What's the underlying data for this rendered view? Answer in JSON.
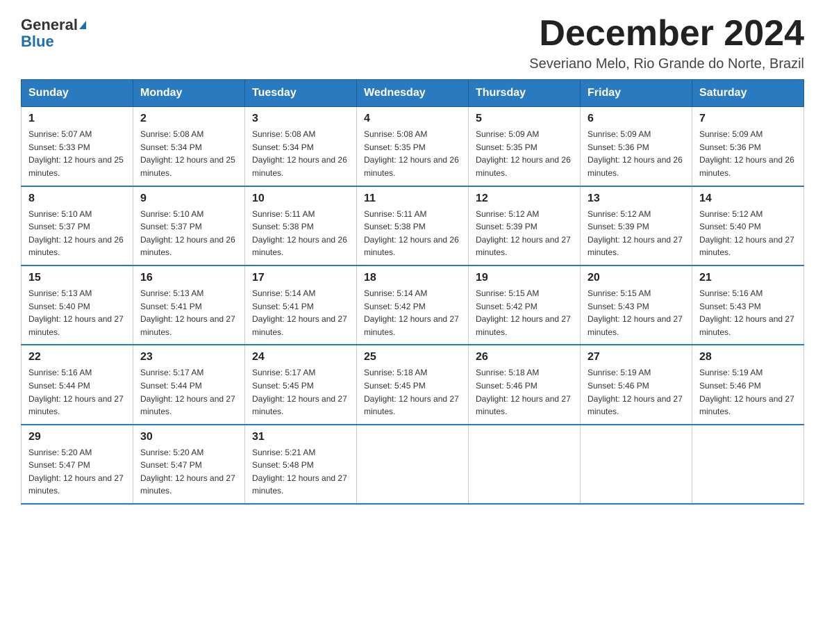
{
  "header": {
    "logo_general": "General",
    "logo_blue": "Blue",
    "month_title": "December 2024",
    "location": "Severiano Melo, Rio Grande do Norte, Brazil"
  },
  "weekdays": [
    "Sunday",
    "Monday",
    "Tuesday",
    "Wednesday",
    "Thursday",
    "Friday",
    "Saturday"
  ],
  "weeks": [
    [
      {
        "day": "1",
        "sunrise": "5:07 AM",
        "sunset": "5:33 PM",
        "daylight": "12 hours and 25 minutes."
      },
      {
        "day": "2",
        "sunrise": "5:08 AM",
        "sunset": "5:34 PM",
        "daylight": "12 hours and 25 minutes."
      },
      {
        "day": "3",
        "sunrise": "5:08 AM",
        "sunset": "5:34 PM",
        "daylight": "12 hours and 26 minutes."
      },
      {
        "day": "4",
        "sunrise": "5:08 AM",
        "sunset": "5:35 PM",
        "daylight": "12 hours and 26 minutes."
      },
      {
        "day": "5",
        "sunrise": "5:09 AM",
        "sunset": "5:35 PM",
        "daylight": "12 hours and 26 minutes."
      },
      {
        "day": "6",
        "sunrise": "5:09 AM",
        "sunset": "5:36 PM",
        "daylight": "12 hours and 26 minutes."
      },
      {
        "day": "7",
        "sunrise": "5:09 AM",
        "sunset": "5:36 PM",
        "daylight": "12 hours and 26 minutes."
      }
    ],
    [
      {
        "day": "8",
        "sunrise": "5:10 AM",
        "sunset": "5:37 PM",
        "daylight": "12 hours and 26 minutes."
      },
      {
        "day": "9",
        "sunrise": "5:10 AM",
        "sunset": "5:37 PM",
        "daylight": "12 hours and 26 minutes."
      },
      {
        "day": "10",
        "sunrise": "5:11 AM",
        "sunset": "5:38 PM",
        "daylight": "12 hours and 26 minutes."
      },
      {
        "day": "11",
        "sunrise": "5:11 AM",
        "sunset": "5:38 PM",
        "daylight": "12 hours and 26 minutes."
      },
      {
        "day": "12",
        "sunrise": "5:12 AM",
        "sunset": "5:39 PM",
        "daylight": "12 hours and 27 minutes."
      },
      {
        "day": "13",
        "sunrise": "5:12 AM",
        "sunset": "5:39 PM",
        "daylight": "12 hours and 27 minutes."
      },
      {
        "day": "14",
        "sunrise": "5:12 AM",
        "sunset": "5:40 PM",
        "daylight": "12 hours and 27 minutes."
      }
    ],
    [
      {
        "day": "15",
        "sunrise": "5:13 AM",
        "sunset": "5:40 PM",
        "daylight": "12 hours and 27 minutes."
      },
      {
        "day": "16",
        "sunrise": "5:13 AM",
        "sunset": "5:41 PM",
        "daylight": "12 hours and 27 minutes."
      },
      {
        "day": "17",
        "sunrise": "5:14 AM",
        "sunset": "5:41 PM",
        "daylight": "12 hours and 27 minutes."
      },
      {
        "day": "18",
        "sunrise": "5:14 AM",
        "sunset": "5:42 PM",
        "daylight": "12 hours and 27 minutes."
      },
      {
        "day": "19",
        "sunrise": "5:15 AM",
        "sunset": "5:42 PM",
        "daylight": "12 hours and 27 minutes."
      },
      {
        "day": "20",
        "sunrise": "5:15 AM",
        "sunset": "5:43 PM",
        "daylight": "12 hours and 27 minutes."
      },
      {
        "day": "21",
        "sunrise": "5:16 AM",
        "sunset": "5:43 PM",
        "daylight": "12 hours and 27 minutes."
      }
    ],
    [
      {
        "day": "22",
        "sunrise": "5:16 AM",
        "sunset": "5:44 PM",
        "daylight": "12 hours and 27 minutes."
      },
      {
        "day": "23",
        "sunrise": "5:17 AM",
        "sunset": "5:44 PM",
        "daylight": "12 hours and 27 minutes."
      },
      {
        "day": "24",
        "sunrise": "5:17 AM",
        "sunset": "5:45 PM",
        "daylight": "12 hours and 27 minutes."
      },
      {
        "day": "25",
        "sunrise": "5:18 AM",
        "sunset": "5:45 PM",
        "daylight": "12 hours and 27 minutes."
      },
      {
        "day": "26",
        "sunrise": "5:18 AM",
        "sunset": "5:46 PM",
        "daylight": "12 hours and 27 minutes."
      },
      {
        "day": "27",
        "sunrise": "5:19 AM",
        "sunset": "5:46 PM",
        "daylight": "12 hours and 27 minutes."
      },
      {
        "day": "28",
        "sunrise": "5:19 AM",
        "sunset": "5:46 PM",
        "daylight": "12 hours and 27 minutes."
      }
    ],
    [
      {
        "day": "29",
        "sunrise": "5:20 AM",
        "sunset": "5:47 PM",
        "daylight": "12 hours and 27 minutes."
      },
      {
        "day": "30",
        "sunrise": "5:20 AM",
        "sunset": "5:47 PM",
        "daylight": "12 hours and 27 minutes."
      },
      {
        "day": "31",
        "sunrise": "5:21 AM",
        "sunset": "5:48 PM",
        "daylight": "12 hours and 27 minutes."
      },
      null,
      null,
      null,
      null
    ]
  ]
}
